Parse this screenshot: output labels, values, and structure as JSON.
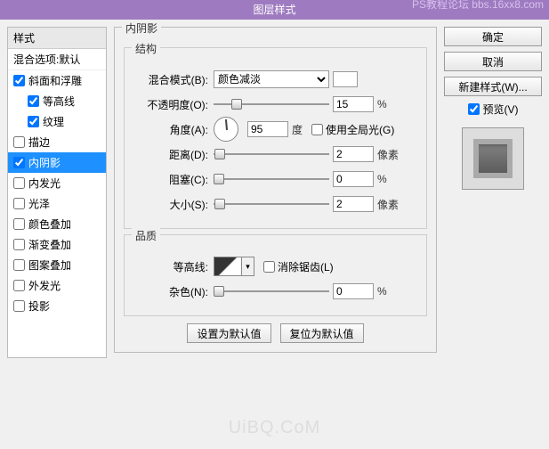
{
  "title": "图层样式",
  "watermark_top": "PS教程论坛\nbbs.16xx8.com",
  "watermark_bottom": "UiBQ.CoM",
  "sidebar": {
    "header": "样式",
    "subheader": "混合选项:默认",
    "items": [
      {
        "label": "斜面和浮雕",
        "checked": true,
        "indent": false
      },
      {
        "label": "等高线",
        "checked": true,
        "indent": true
      },
      {
        "label": "纹理",
        "checked": true,
        "indent": true
      },
      {
        "label": "描边",
        "checked": false,
        "indent": false
      },
      {
        "label": "内阴影",
        "checked": true,
        "indent": false,
        "selected": true
      },
      {
        "label": "内发光",
        "checked": false,
        "indent": false
      },
      {
        "label": "光泽",
        "checked": false,
        "indent": false
      },
      {
        "label": "颜色叠加",
        "checked": false,
        "indent": false
      },
      {
        "label": "渐变叠加",
        "checked": false,
        "indent": false
      },
      {
        "label": "图案叠加",
        "checked": false,
        "indent": false
      },
      {
        "label": "外发光",
        "checked": false,
        "indent": false
      },
      {
        "label": "投影",
        "checked": false,
        "indent": false
      }
    ]
  },
  "main": {
    "heading": "内阴影",
    "structure": {
      "title": "结构",
      "blend_mode_label": "混合模式(B):",
      "blend_mode_value": "颜色减淡",
      "opacity_label": "不透明度(O):",
      "opacity_value": "15",
      "opacity_unit": "%",
      "angle_label": "角度(A):",
      "angle_value": "95",
      "angle_unit": "度",
      "global_light_label": "使用全局光(G)",
      "global_light_checked": false,
      "distance_label": "距离(D):",
      "distance_value": "2",
      "distance_unit": "像素",
      "choke_label": "阻塞(C):",
      "choke_value": "0",
      "choke_unit": "%",
      "size_label": "大小(S):",
      "size_value": "2",
      "size_unit": "像素"
    },
    "quality": {
      "title": "品质",
      "contour_label": "等高线:",
      "antialias_label": "消除锯齿(L)",
      "antialias_checked": false,
      "noise_label": "杂色(N):",
      "noise_value": "0",
      "noise_unit": "%"
    },
    "buttons": {
      "default_set": "设置为默认值",
      "default_reset": "复位为默认值"
    }
  },
  "right": {
    "ok": "确定",
    "cancel": "取消",
    "new_style": "新建样式(W)...",
    "preview_label": "预览(V)",
    "preview_checked": true
  }
}
